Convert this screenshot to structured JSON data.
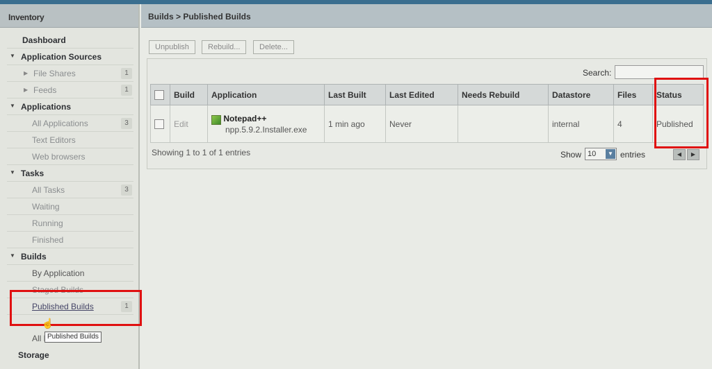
{
  "sidebar": {
    "title": "Inventory",
    "items": [
      {
        "label": "Dashboard"
      },
      {
        "label": "Application Sources",
        "toggle": "▼"
      },
      {
        "label": "File Shares",
        "count": "1"
      },
      {
        "label": "Feeds",
        "count": "1"
      },
      {
        "label": "Applications",
        "toggle": "▼"
      },
      {
        "label": "All Applications",
        "count": "3"
      },
      {
        "label": "Text Editors"
      },
      {
        "label": "Web browsers"
      },
      {
        "label": "Tasks",
        "toggle": "▼"
      },
      {
        "label": "All Tasks",
        "count": "3"
      },
      {
        "label": "Waiting"
      },
      {
        "label": "Running"
      },
      {
        "label": "Finished"
      },
      {
        "label": "Builds",
        "toggle": "▼"
      },
      {
        "label": "By Application"
      },
      {
        "label": "Staged Builds"
      },
      {
        "label": "Published Builds",
        "count": "1"
      },
      {
        "label": "All Builds"
      },
      {
        "label": "Storage"
      }
    ],
    "tooltip": "Published Builds"
  },
  "main": {
    "breadcrumb": "Builds > Published Builds",
    "toolbar": {
      "unpublish": "Unpublish",
      "rebuild": "Rebuild...",
      "delete": "Delete..."
    },
    "search": {
      "label": "Search:",
      "value": ""
    },
    "table": {
      "columns": [
        "Build",
        "Application",
        "Last Built",
        "Last Edited",
        "Needs Rebuild",
        "Datastore",
        "Files",
        "Status"
      ],
      "rows": [
        {
          "build": "Edit",
          "app_name": "Notepad++",
          "app_file": "npp.5.9.2.Installer.exe",
          "last_built": "1 min ago",
          "last_edited": "Never",
          "needs_rebuild": "",
          "datastore": "internal",
          "files": "4",
          "status": "Published"
        }
      ]
    },
    "footer": {
      "showing": "Showing 1 to 1 of 1 entries",
      "show_label": "Show",
      "page_size": "10",
      "entries_label": "entries"
    }
  },
  "colors": {
    "highlight": "#e01010",
    "header": "#b5c0c5"
  }
}
